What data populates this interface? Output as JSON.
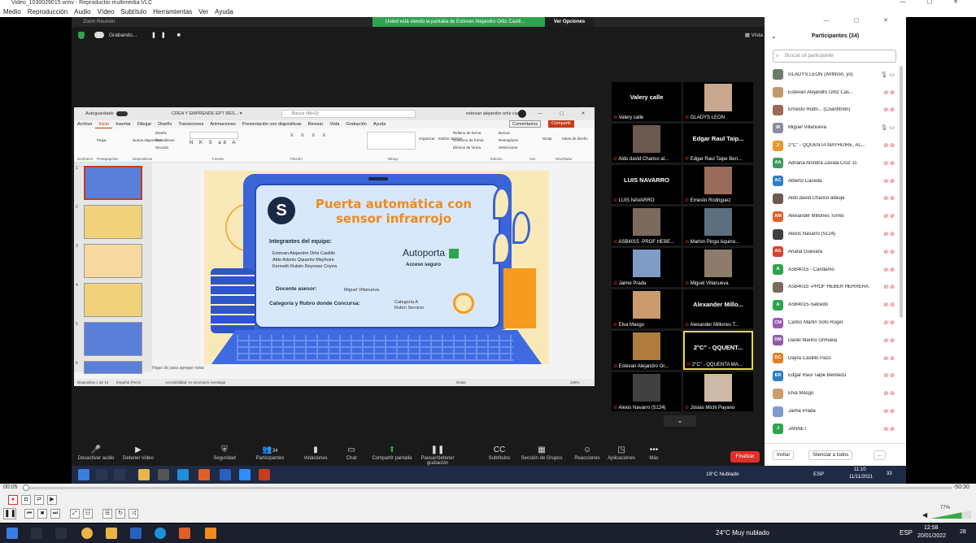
{
  "vlc": {
    "title": "Video_1030029015.wmv - Reproductor multimedia VLC",
    "menu": [
      "Medio",
      "Reproducción",
      "Audio",
      "Vídeo",
      "Subtítulo",
      "Herramientas",
      "Ver",
      "Ayuda"
    ],
    "time_elapsed": "00:05",
    "time_total": "-50:30",
    "volume": "77%"
  },
  "zoom": {
    "window_title": "Zoom Reunión",
    "share_banner": "Usted está viendo la pantalla de Estevan Alejandro Ortiz Castil...",
    "view_options": "Ver Opciones",
    "recording": "Grabando...",
    "view_label": "Vista",
    "toolbar": [
      {
        "label": "Desactivar audio",
        "icon": "microphone-icon"
      },
      {
        "label": "Detener vídeo",
        "icon": "video-camera-icon"
      },
      {
        "label": "Seguridad",
        "icon": "shield-icon"
      },
      {
        "label": "Participantes",
        "icon": "participants-icon",
        "count": "34"
      },
      {
        "label": "Votaciones",
        "icon": "poll-icon"
      },
      {
        "label": "Chat",
        "icon": "chat-icon"
      },
      {
        "label": "Compartir pantalla",
        "icon": "share-screen-icon"
      },
      {
        "label": "Pausar/detener grabación",
        "icon": "pause-recording-icon"
      },
      {
        "label": "Subtítulos",
        "icon": "cc-icon"
      },
      {
        "label": "Sección de Grupos",
        "icon": "breakout-icon"
      },
      {
        "label": "Reacciones",
        "icon": "reaction-icon"
      },
      {
        "label": "Aplicaciones",
        "icon": "apps-icon"
      },
      {
        "label": "Más",
        "icon": "more-icon"
      }
    ],
    "finalizar": "Finalizar"
  },
  "ppt": {
    "autosave": "Autoguardado",
    "file_name": "CREA Y EMPRENDE EPT RES... ▾",
    "search": "Buscar (Alt+Q)",
    "user": "estevan alejandro ortiz castillo",
    "tabs": [
      "Archivo",
      "Inicio",
      "Insertar",
      "Dibujar",
      "Diseño",
      "Transiciones",
      "Animaciones",
      "Presentación con diapositivas",
      "Revisar",
      "Vista",
      "Grabación",
      "Ayuda"
    ],
    "active_tab": "Inicio",
    "comments": "Comentarios",
    "share": "Compartir",
    "ribbon_groups": [
      "Deshacer",
      "Portapapeles",
      "Diapositivas",
      "Fuente",
      "Párrafo",
      "Dibujo",
      "Edición",
      "Voz",
      "Diseñador"
    ],
    "ribbon_items": [
      "Pegar",
      "Nueva diapositiva",
      "Diseño",
      "Restablecer",
      "Sección",
      "Organizar",
      "Estilos rápidos",
      "Relleno de forma",
      "Contorno de forma",
      "Efectos de forma",
      "Buscar",
      "Reemplazar",
      "Seleccionar",
      "Dictar",
      "Ideas de diseño"
    ],
    "thumb_numbers": [
      "1",
      "2",
      "3",
      "4",
      "5",
      "6"
    ],
    "notes": "Haga clic para agregar notas",
    "status_left": "Diapositiva 1 de 13",
    "status_lang": "Español (Perú)",
    "status_access": "Accesibilidad: es necesario investigar",
    "status_notes": "Notas",
    "zoom_level": "106%"
  },
  "slide": {
    "title_line1": "Puerta automática con",
    "title_line2": "sensor infrarrojo",
    "team_label": "Integrantes del equipo:",
    "members": [
      "Estevan Alejandro Ortiz Castillo",
      "Aldo Adonis Qquento Mayhuire",
      "Kenneth Rubén Reynoso Coyea"
    ],
    "brand": "Autoporta",
    "tagline": "Acceso seguro",
    "advisor_label": "Docente asesor:",
    "advisor": "Miguel Villanueva",
    "category_label": "Categoría y Rubro donde Concursa:",
    "category_1": "Categoría A",
    "category_2": "Rubro Servicio"
  },
  "gallery": [
    {
      "name": "Valery calle",
      "label": "Valery calle",
      "type": "text"
    },
    {
      "name": "GLADYS LEON",
      "type": "photo",
      "color": "#c7a88e"
    },
    {
      "name": "Aldo david Chanco al...",
      "type": "photo",
      "color": "#6c5a52"
    },
    {
      "name": "Edgar Raul Taipe Ben...",
      "label": "Edgar Raul Taip...",
      "type": "text"
    },
    {
      "name": "LUIS NAVARRO",
      "label": "LUIS NAVARRO",
      "type": "text"
    },
    {
      "name": "Ernesto Rodriguez",
      "type": "photo",
      "color": "#9a6a5a"
    },
    {
      "name": "ASB4015 -PROF HEBE...",
      "type": "photo",
      "color": "#7d6a5e"
    },
    {
      "name": "Marlon Pingo Aquino...",
      "type": "photo",
      "color": "#5b6f7e"
    },
    {
      "name": "Jaime Prada",
      "type": "photo",
      "color": "#7f9bc6"
    },
    {
      "name": "Miguel Villanueva",
      "type": "photo",
      "color": "#8d7b6c"
    },
    {
      "name": "Elva Masgo",
      "type": "photo",
      "color": "#c99b6d"
    },
    {
      "name": "Alexander Millones T...",
      "label": "Alexander Millo...",
      "type": "text"
    },
    {
      "name": "Estevan Alejandro Or...",
      "type": "photo",
      "color": "#b07b3e"
    },
    {
      "name": "2°C\" - QQUENTA MA...",
      "label": "2°C\" - QQUENT...",
      "type": "text"
    },
    {
      "name": "Alexis Navarro (5124)",
      "type": "photo",
      "color": "#404040"
    },
    {
      "name": "Josias Michi Payano",
      "type": "photo",
      "color": "#d0b8a8"
    }
  ],
  "participants": {
    "header": "Participantes (34)",
    "search_placeholder": "Buscar un participante",
    "list": [
      {
        "name": "GLADYS LEON (Anfitrión, yo)",
        "initials": "",
        "color": "#6b7c68",
        "mic": "on"
      },
      {
        "name": "Estevan Alejandro Ortiz Cas...",
        "initials": "",
        "color": "#c59a6a",
        "mic": "off"
      },
      {
        "name": "Ernesto Rodri... (Coanfitrión)",
        "initials": "",
        "color": "#9a6a5a",
        "mic": "off"
      },
      {
        "name": "Miguel Villanueva",
        "initials": "M",
        "color": "#8c8c9c",
        "mic": "on"
      },
      {
        "name": "2°C\" - QQUENTA MAYHUIRE, AL...",
        "initials": "2",
        "color": "#e69a28",
        "mic": "off"
      },
      {
        "name": "Adriana Alondra Zavala Cruz 1c",
        "initials": "AA",
        "color": "#3b9c5c",
        "mic": "off"
      },
      {
        "name": "Alberto Caceda",
        "initials": "AC",
        "color": "#2f7fc1",
        "mic": "off"
      },
      {
        "name": "Aldo david Chanco allauja",
        "initials": "",
        "color": "#6c5a52",
        "mic": "off"
      },
      {
        "name": "Alexander Millones Torres",
        "initials": "AM",
        "color": "#e0602a",
        "mic": "off"
      },
      {
        "name": "Alexis Navarro (5124)",
        "initials": "",
        "color": "#404040",
        "mic": "off"
      },
      {
        "name": "Ariana Guevara",
        "initials": "AG",
        "color": "#d2442c",
        "mic": "off"
      },
      {
        "name": "ASB4015 - Candamo",
        "initials": "A",
        "color": "#2ea44f",
        "mic": "off"
      },
      {
        "name": "ASB4015 -PROF HEBER HERRERA",
        "initials": "",
        "color": "#7d6a5e",
        "mic": "off"
      },
      {
        "name": "ASB4015-Salcedo",
        "initials": "A",
        "color": "#2ea44f",
        "mic": "off"
      },
      {
        "name": "Carlos Martin Soto Rugel",
        "initials": "CM",
        "color": "#9b59b6",
        "mic": "off"
      },
      {
        "name": "Dariel Mariño Orihuela",
        "initials": "DM",
        "color": "#8e5aa8",
        "mic": "off"
      },
      {
        "name": "Dayra Castillo Pazo",
        "initials": "DC",
        "color": "#e67e22",
        "mic": "off"
      },
      {
        "name": "Edgar Raul Taipe Bendezú",
        "initials": "ER",
        "color": "#2f7fc1",
        "mic": "off"
      },
      {
        "name": "Elva Masgo",
        "initials": "",
        "color": "#c99b6d",
        "mic": "off"
      },
      {
        "name": "Jaime Prada",
        "initials": "",
        "color": "#7f9bc6",
        "mic": "off"
      },
      {
        "name": "JANNET",
        "initials": "J",
        "color": "#2ea44f",
        "mic": "off"
      }
    ],
    "invite": "Invitar",
    "mute_all": "Silenciar a todos",
    "more": "..."
  },
  "remote_taskbar": {
    "weather": "19°C  Nublado",
    "lang": "ESP",
    "time": "11:10",
    "date": "11/11/2021",
    "badge": "33"
  },
  "local_taskbar": {
    "weather": "24°C  Muy nublado",
    "lang": "ESP",
    "time": "12:58",
    "date": "20/01/2022",
    "badge": "28"
  }
}
